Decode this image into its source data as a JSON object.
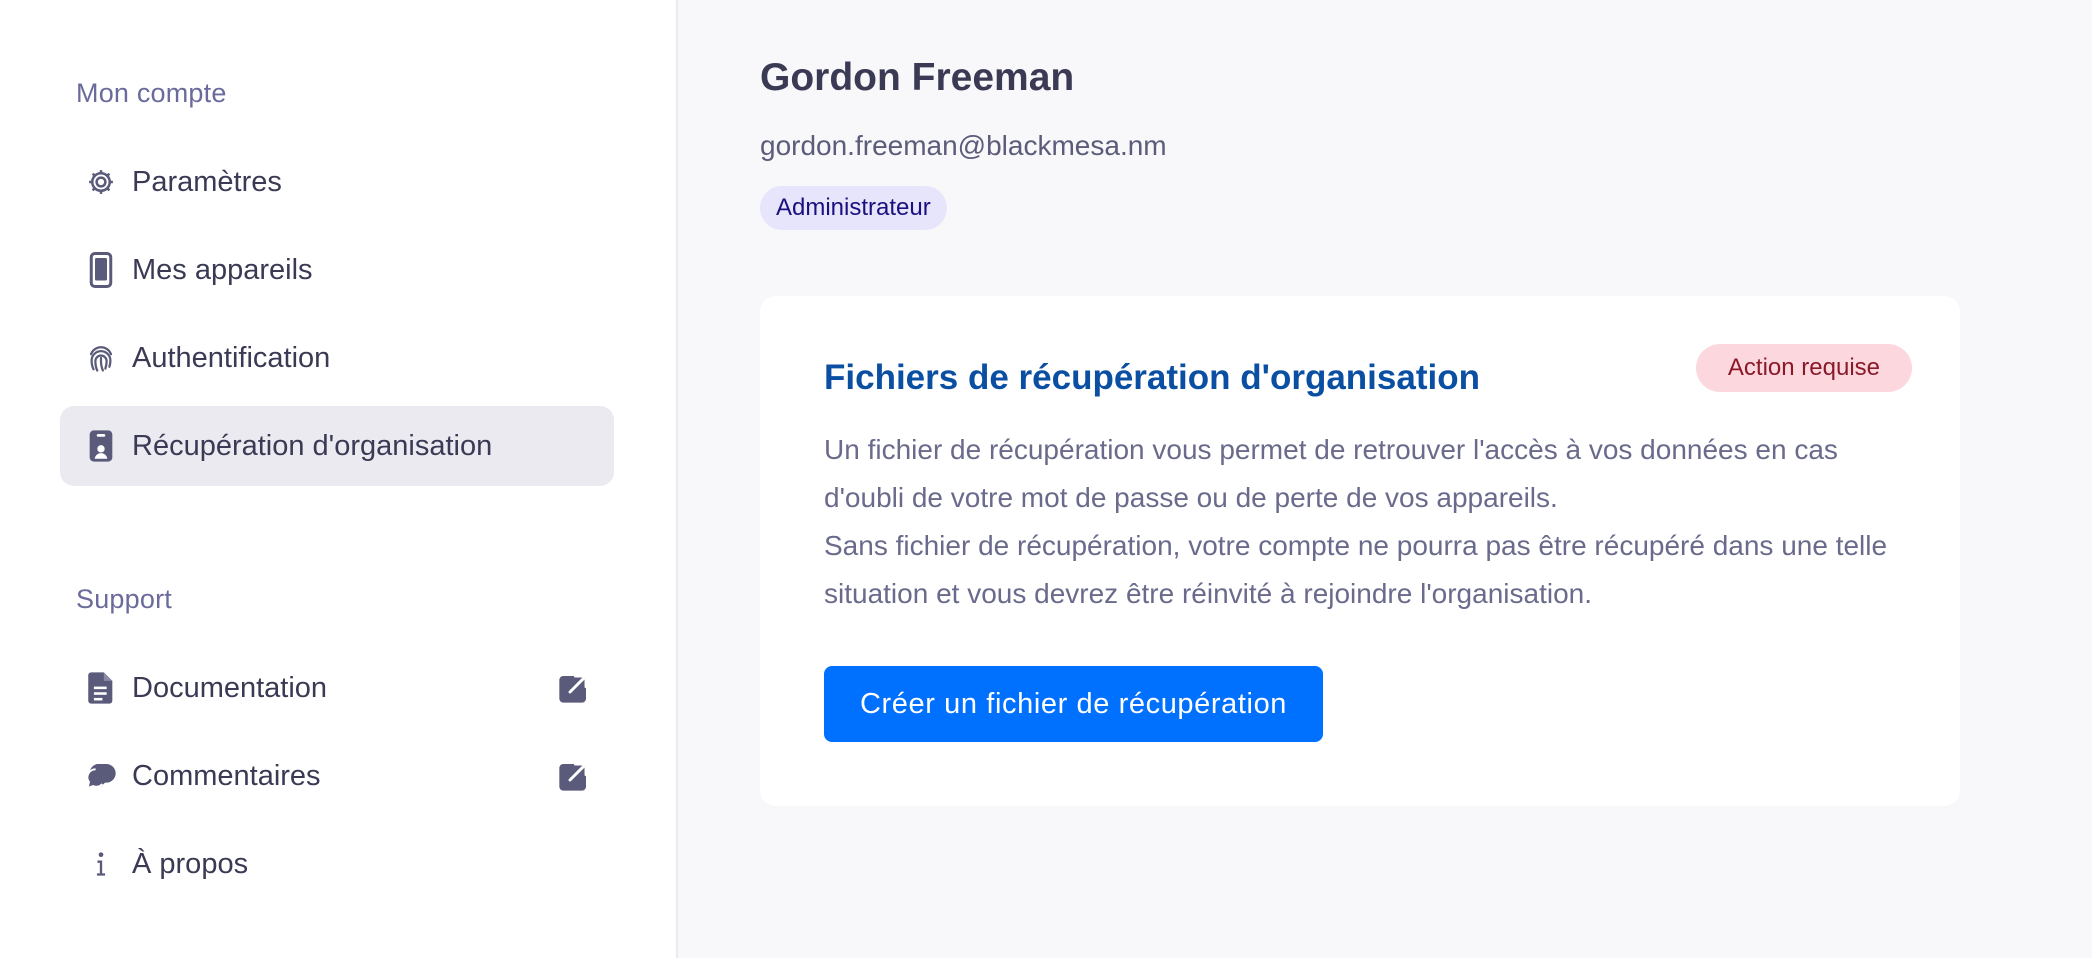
{
  "sidebar": {
    "account_section": "Mon compte",
    "account_items": [
      {
        "label": "Paramètres",
        "icon": "gear-icon"
      },
      {
        "label": "Mes appareils",
        "icon": "phone-icon"
      },
      {
        "label": "Authentification",
        "icon": "fingerprint-icon"
      },
      {
        "label": "Récupération d'organisation",
        "icon": "badge-id-icon",
        "active": true
      }
    ],
    "support_section": "Support",
    "support_items": [
      {
        "label": "Documentation",
        "icon": "document-icon",
        "external": true
      },
      {
        "label": "Commentaires",
        "icon": "chat-bubbles-icon",
        "external": true
      },
      {
        "label": "À propos",
        "icon": "info-icon"
      }
    ]
  },
  "user": {
    "name": "Gordon Freeman",
    "email": "gordon.freeman@blackmesa.nm",
    "role": "Administrateur"
  },
  "recovery_card": {
    "title": "Fichiers de récupération d'organisation",
    "status_badge": "Action requise",
    "description_line1": "Un fichier de récupération vous permet de retrouver l'accès à vos données en cas d'oubli de votre mot de passe ou de perte de vos appareils.",
    "description_line2": "Sans fichier de récupération, votre compte ne pourra pas être récupéré dans une telle situation et vous devrez être réinvité à rejoindre l'organisation.",
    "button_label": "Créer un fichier de récupération"
  },
  "colors": {
    "accent": "#0070ff",
    "card_title": "#0b4fa3",
    "role_badge_bg": "#e6e5fb",
    "action_badge_bg": "#fcd7dd",
    "sidebar_active_bg": "#eaeaf0"
  }
}
